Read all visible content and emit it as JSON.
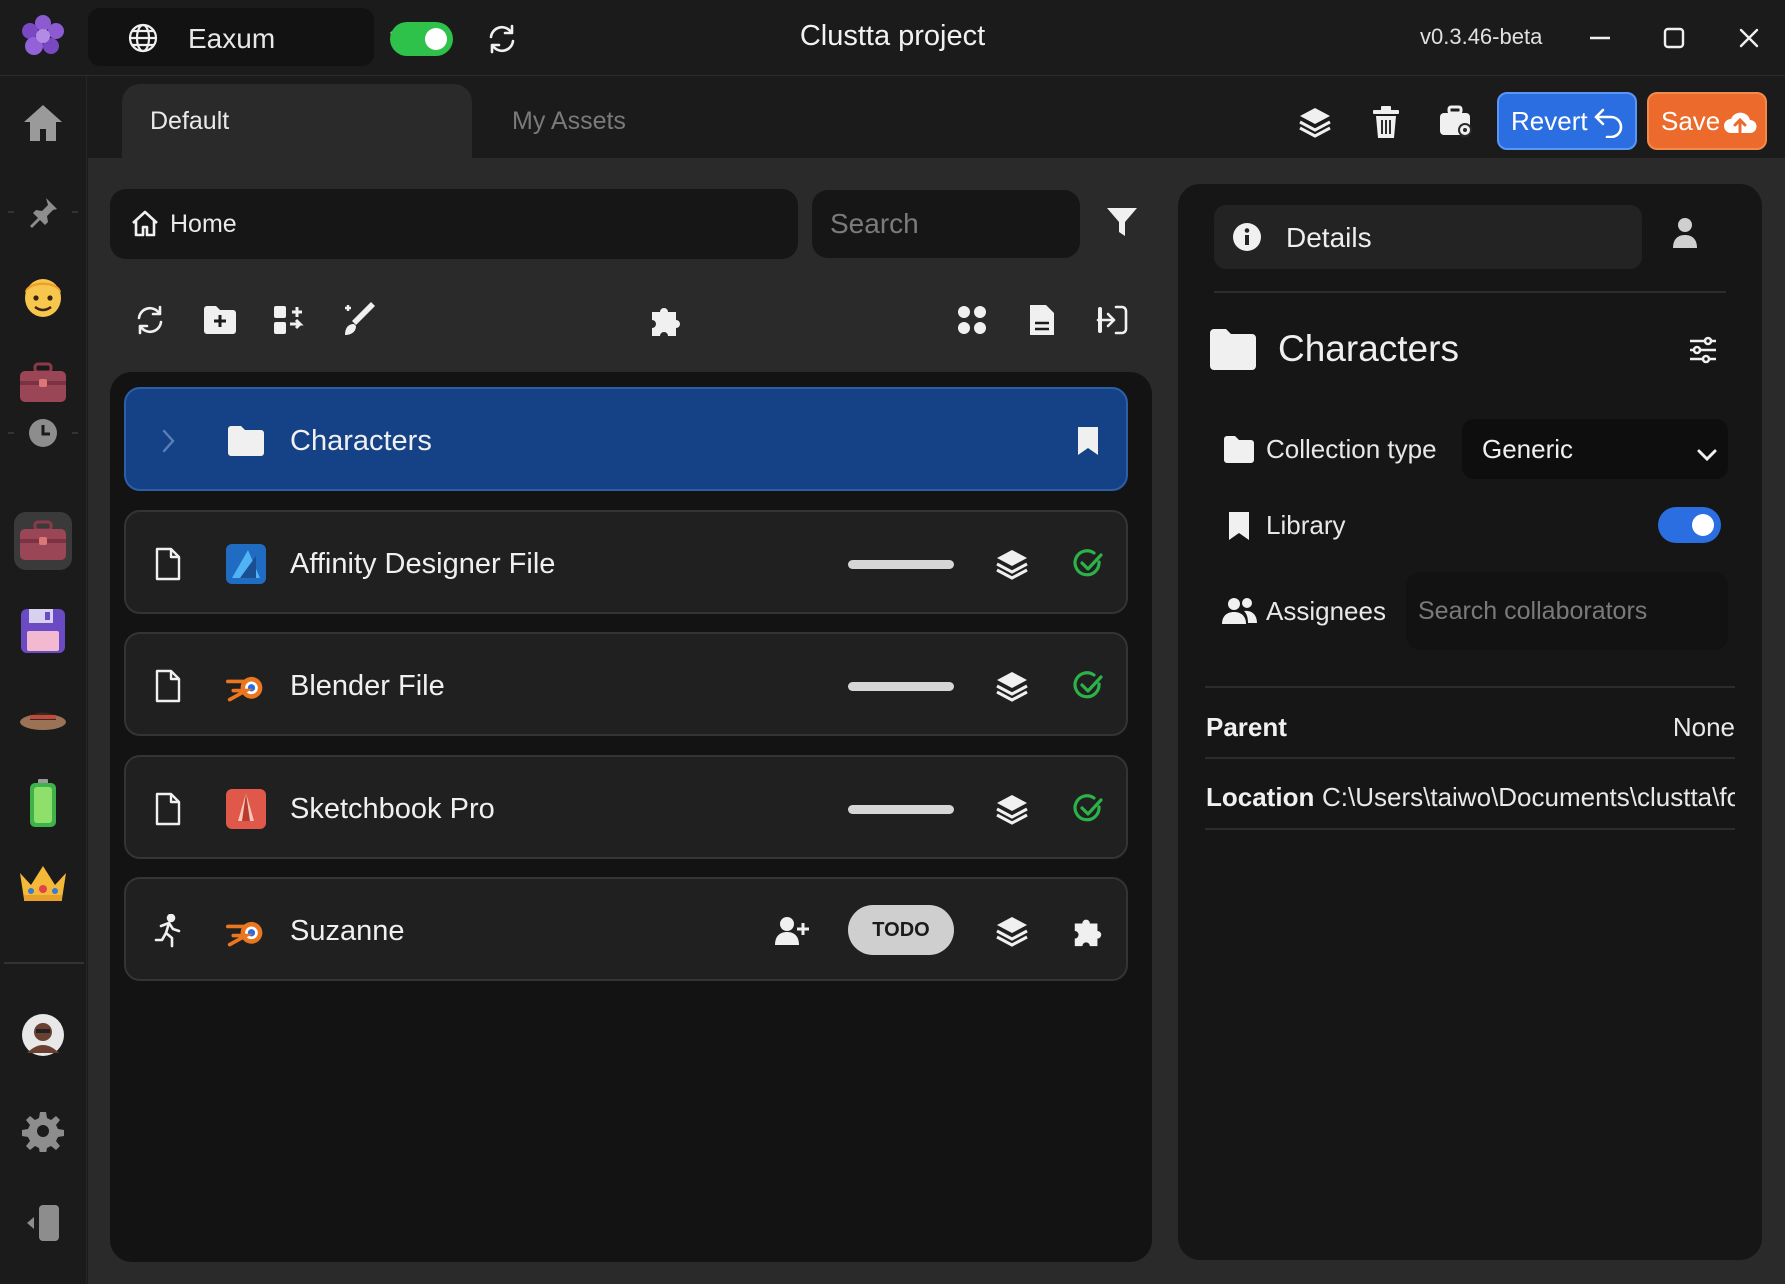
{
  "window": {
    "title": "Clustta project",
    "version": "v0.3.46-beta"
  },
  "workspace": {
    "name": "Eaxum",
    "sync_enabled": true
  },
  "tabs": [
    {
      "label": "Default",
      "active": true
    },
    {
      "label": "My Assets",
      "active": false
    }
  ],
  "toolbar": {
    "revert_label": "Revert",
    "save_label": "Save",
    "revert_color": "#2a6ee2",
    "save_color": "#ec6a2c"
  },
  "browser": {
    "breadcrumb": "Home",
    "search_placeholder": "Search",
    "rows": [
      {
        "name": "Characters",
        "type_icon": "folder-icon",
        "selected": true
      },
      {
        "name": "Affinity Designer File",
        "type_icon": "file-icon",
        "app_icon": "affinity-designer-icon",
        "status": "approved"
      },
      {
        "name": "Blender File",
        "type_icon": "file-icon",
        "app_icon": "blender-icon",
        "status": "approved"
      },
      {
        "name": "Sketchbook Pro",
        "type_icon": "file-icon",
        "app_icon": "sketchbook-icon",
        "status": "approved"
      },
      {
        "name": "Suzanne",
        "type_icon": "running-icon",
        "app_icon": "blender-icon",
        "tag": "TODO"
      }
    ]
  },
  "details": {
    "tab_label": "Details",
    "title": "Characters",
    "collection_type_label": "Collection type",
    "collection_type_value": "Generic",
    "library_label": "Library",
    "library_enabled": true,
    "assignees_label": "Assignees",
    "assignees_placeholder": "Search collaborators",
    "parent_label": "Parent",
    "parent_value": "None",
    "location_label": "Location",
    "location_value": "C:\\Users\\taiwo\\Documents\\clustta\\fo"
  }
}
